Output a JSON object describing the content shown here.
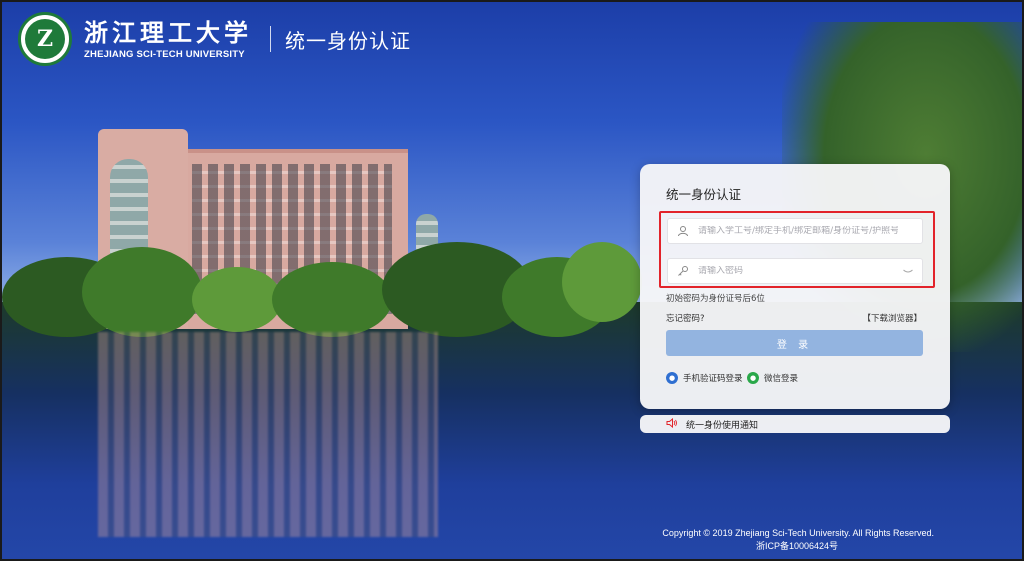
{
  "header": {
    "school_name_cn": "浙江理工大学",
    "school_name_en": "ZHEJIANG SCI-TECH UNIVERSITY",
    "system_name": "统一身份认证",
    "emblem_letter": "Z"
  },
  "login_card": {
    "title": "统一身份认证",
    "username_placeholder": "请输入学工号/绑定手机/绑定邮箱/身份证号/护照号",
    "password_placeholder": "请输入密码",
    "password_hint": "初始密码为身份证号后6位",
    "forgot_password": "忘记密码?",
    "download_browser": "【下载浏览器】",
    "login_button": "登 录",
    "sms_login": "手机验证码登录",
    "wechat_login": "微信登录"
  },
  "notice": {
    "text": "统一身份使用通知"
  },
  "footer": {
    "copyright": "Copyright © 2019 Zhejiang Sci-Tech University. All Rights Reserved.",
    "icp": "浙ICP备10006424号"
  },
  "colors": {
    "highlight_border": "#e2232a",
    "login_button_bg": "#93b4e0",
    "emblem_green": "#1f7a3a"
  },
  "icons": {
    "user_field": "user-icon",
    "password_field": "key-icon",
    "password_toggle": "eye-icon",
    "sms": "phone-icon",
    "wechat": "wechat-icon",
    "notice": "speaker-icon"
  }
}
